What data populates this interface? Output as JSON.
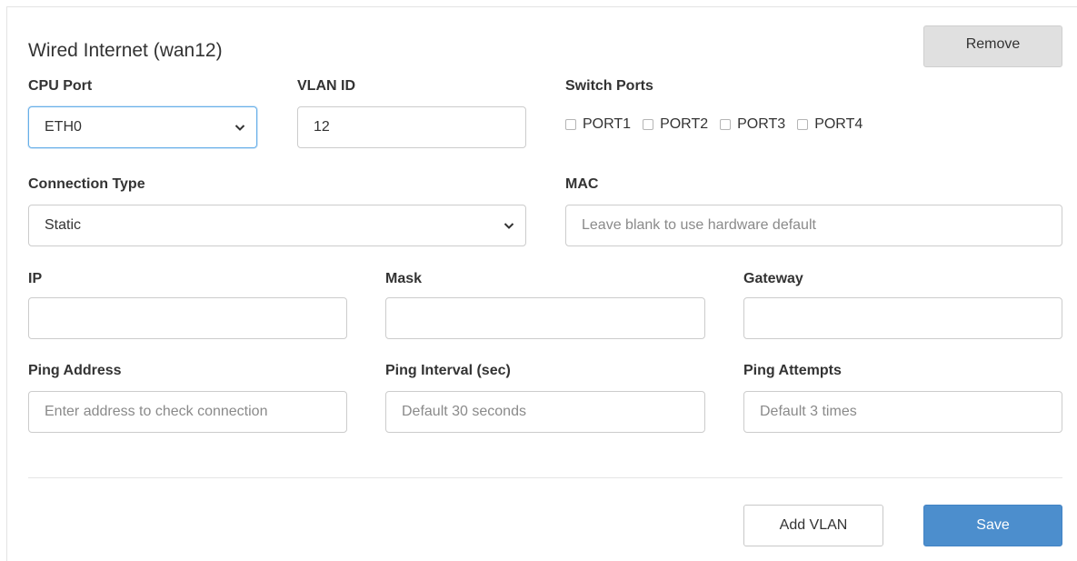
{
  "card": {
    "title": "Wired Internet (wan12)",
    "remove_label": "Remove"
  },
  "cpu_port": {
    "label": "CPU Port",
    "value": "ETH0"
  },
  "vlan_id": {
    "label": "VLAN ID",
    "value": "12"
  },
  "switch_ports": {
    "label": "Switch Ports",
    "ports": [
      {
        "label": "PORT1",
        "checked": false
      },
      {
        "label": "PORT2",
        "checked": false
      },
      {
        "label": "PORT3",
        "checked": false
      },
      {
        "label": "PORT4",
        "checked": false
      }
    ]
  },
  "connection_type": {
    "label": "Connection Type",
    "value": "Static"
  },
  "mac": {
    "label": "MAC",
    "placeholder": "Leave blank to use hardware default",
    "value": ""
  },
  "ip": {
    "label": "IP",
    "value": ""
  },
  "mask": {
    "label": "Mask",
    "value": ""
  },
  "gateway": {
    "label": "Gateway",
    "value": ""
  },
  "ping_address": {
    "label": "Ping Address",
    "placeholder": "Enter address to check connection",
    "value": ""
  },
  "ping_interval": {
    "label": "Ping Interval (sec)",
    "placeholder": "Default 30 seconds",
    "value": ""
  },
  "ping_attempts": {
    "label": "Ping Attempts",
    "placeholder": "Default 3 times",
    "value": ""
  },
  "footer": {
    "add_vlan_label": "Add VLAN",
    "save_label": "Save"
  },
  "colors": {
    "primary": "#4c8ecd",
    "focus_border": "#66afe9",
    "remove_bg": "#e0e0e0"
  },
  "icons": {
    "select_arrow": "chevron-down-icon",
    "port_checkbox": "checkbox-icon"
  }
}
